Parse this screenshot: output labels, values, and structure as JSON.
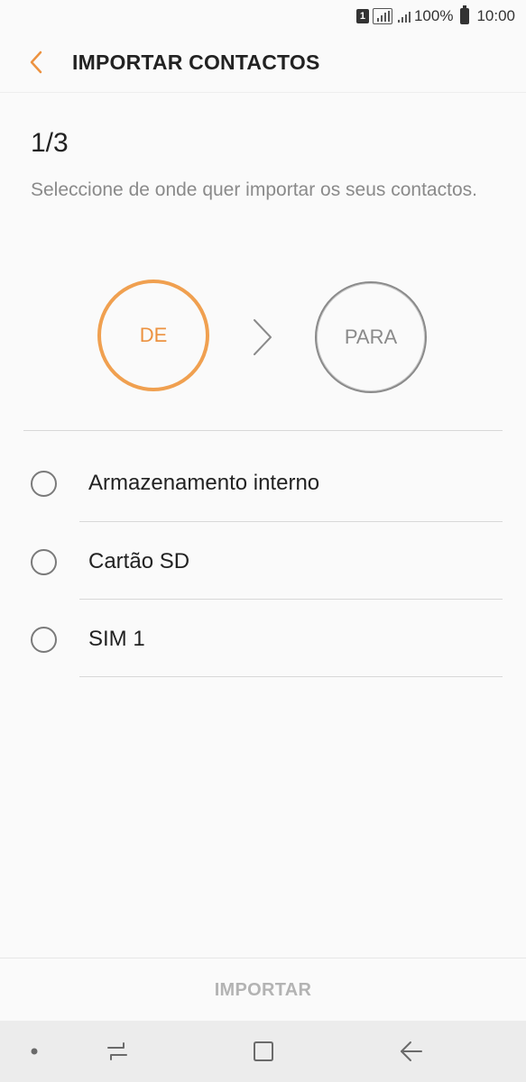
{
  "status_bar": {
    "sim_number": "1",
    "battery_percent": "100%",
    "time": "10:00"
  },
  "header": {
    "title": "IMPORTAR CONTACTOS",
    "back_icon": "chevron-left-icon"
  },
  "step": {
    "counter": "1/3",
    "description": "Seleccione de onde quer importar os seus contactos."
  },
  "flow": {
    "from_label": "DE",
    "to_label": "PARA",
    "active_color": "#ec9240",
    "inactive_color": "#8a8a8a"
  },
  "options": [
    {
      "label": "Armazenamento interno",
      "selected": false
    },
    {
      "label": "Cartão SD",
      "selected": false
    },
    {
      "label": "SIM 1",
      "selected": false
    }
  ],
  "footer": {
    "import_label": "IMPORTAR",
    "enabled": false
  },
  "nav_bar": {
    "icons": [
      "dot-icon",
      "recent-apps-icon",
      "home-icon",
      "back-icon"
    ]
  }
}
